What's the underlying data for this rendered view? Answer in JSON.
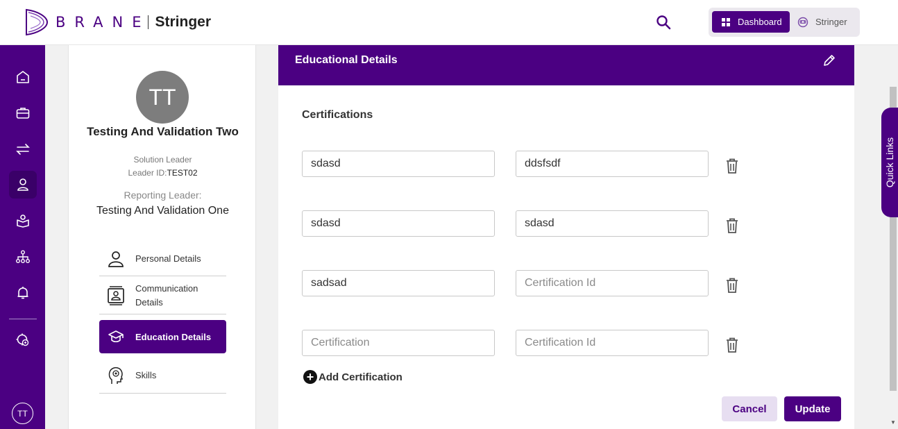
{
  "header": {
    "brand": "BRANE",
    "app_name": "Stringer",
    "switcher": {
      "dashboard_label": "Dashboard",
      "stringer_label": "Stringer"
    }
  },
  "leftnav": {
    "items": [
      "home-icon",
      "briefcase-icon",
      "transfer-icon",
      "user-icon",
      "reader-icon",
      "org-chart-icon",
      "bell-icon",
      "settings-user-icon"
    ],
    "avatar_initials": "TT"
  },
  "profile": {
    "initials": "TT",
    "name": "Testing And Validation Two",
    "role": "Solution Leader",
    "leader_id_label": "Leader ID:",
    "leader_id": "TEST02",
    "reporting_label": "Reporting Leader:",
    "reporting_name": "Testing And Validation One",
    "menu": [
      {
        "label": "Personal Details",
        "icon": "person-icon"
      },
      {
        "label": "Communication Details",
        "icon": "contact-card-icon"
      },
      {
        "label": "Education Details",
        "icon": "graduation-cap-icon"
      },
      {
        "label": "Skills",
        "icon": "head-idea-icon"
      }
    ]
  },
  "main": {
    "title": "Educational Details",
    "section_title": "Certifications",
    "certifications": [
      {
        "name": "sdasd",
        "id": "ddsfsdf"
      },
      {
        "name": "sdasd",
        "id": "sdasd"
      },
      {
        "name": "sadsad",
        "id": ""
      },
      {
        "name": "",
        "id": ""
      }
    ],
    "placeholders": {
      "name": "Certification",
      "id": "Certification Id"
    },
    "add_label": "Add Certification",
    "cancel_label": "Cancel",
    "update_label": "Update"
  },
  "quick_links_label": "Quick Links",
  "colors": {
    "primary": "#4b0082",
    "cancel_bg": "#e7def1"
  }
}
